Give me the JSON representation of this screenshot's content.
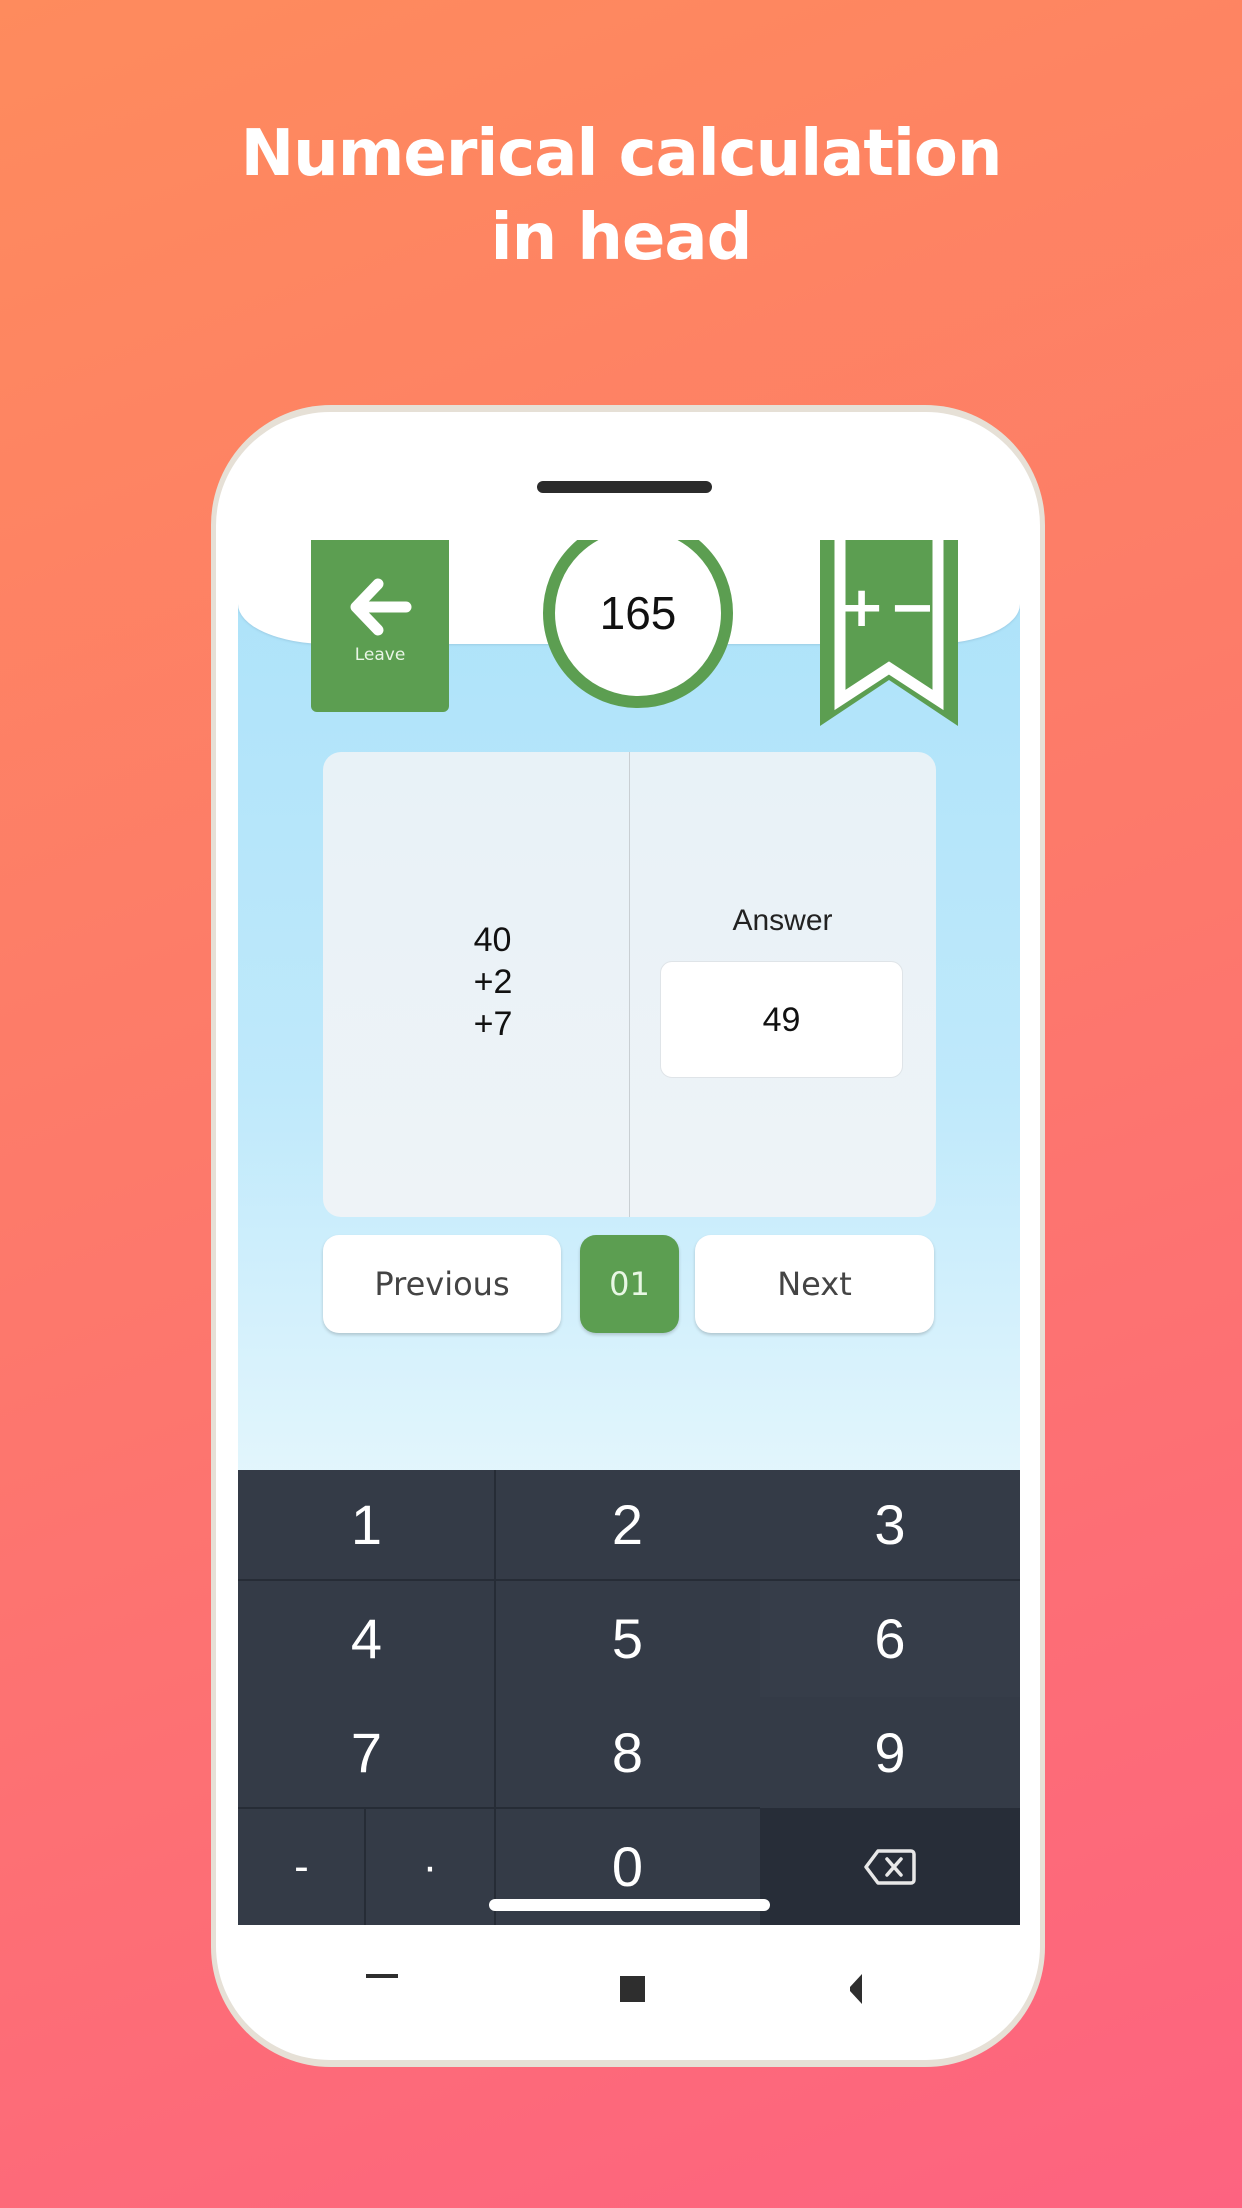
{
  "headline": {
    "line1": "Numerical calculation",
    "line2": "in head"
  },
  "app": {
    "leave_button": {
      "label": "Leave",
      "icon": "arrow-left-icon"
    },
    "score": "165",
    "mode_badge": {
      "label": "+−",
      "icon": "bookmark-icon"
    },
    "problem": {
      "lines": [
        "40",
        "+2",
        "+7"
      ]
    },
    "answer": {
      "label": "Answer",
      "value": "49"
    },
    "navigation": {
      "previous_label": "Previous",
      "page": "01",
      "next_label": "Next"
    },
    "keypad": {
      "rows": [
        [
          "1",
          "2",
          "3"
        ],
        [
          "4",
          "5",
          "6"
        ],
        [
          "7",
          "8",
          "9"
        ]
      ],
      "bottom_row": {
        "minus": "-",
        "dot": "·",
        "zero": "0",
        "backspace_icon": "backspace-icon"
      }
    },
    "system_nav": [
      "recents-icon",
      "home-icon",
      "back-icon"
    ]
  },
  "colors": {
    "accent_green": "#5c9e51",
    "keyboard_bg": "#343b47",
    "background_start": "#fe8b5d",
    "background_end": "#fd6380"
  }
}
